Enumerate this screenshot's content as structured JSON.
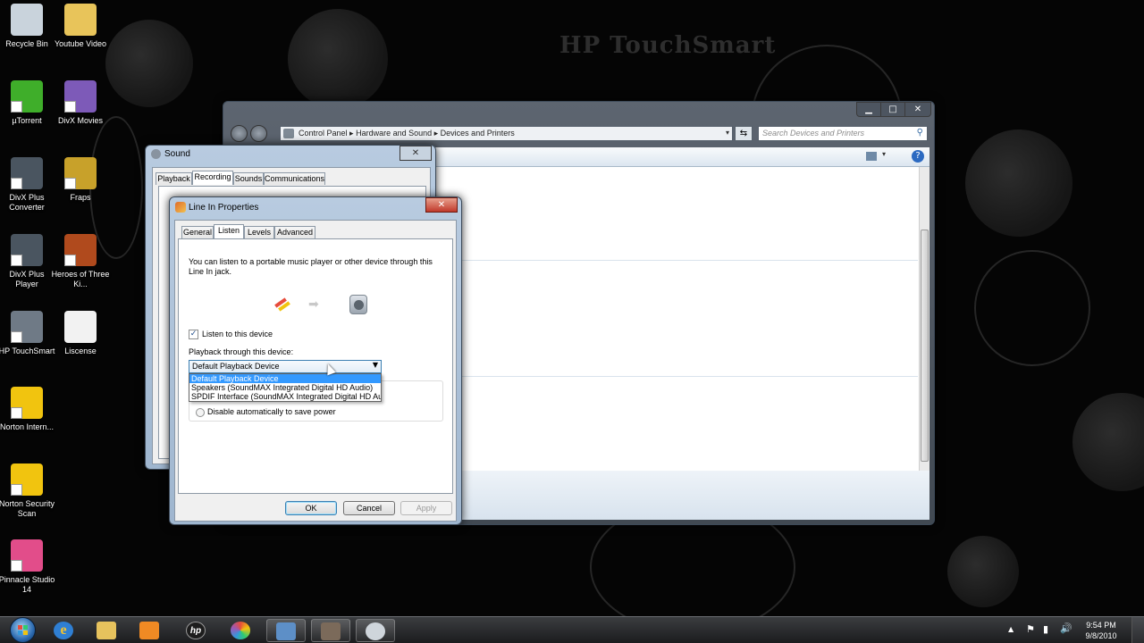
{
  "wallpaper": {
    "brand": "HP TouchSmart"
  },
  "desktop_icons": [
    {
      "label": "Recycle Bin",
      "icon": "recycle-bin-icon",
      "color": "#c9d3dc"
    },
    {
      "label": "Youtube Video",
      "icon": "folder-icon",
      "color": "#e8c45a"
    },
    {
      "label": "µTorrent",
      "icon": "utorrent-icon",
      "color": "#3fae2a"
    },
    {
      "label": "DivX Movies",
      "icon": "divx-movies-icon",
      "color": "#7d5ab8"
    },
    {
      "label": "DivX Plus Converter",
      "icon": "divx-converter-icon",
      "color": "#4a5560"
    },
    {
      "label": "Fraps",
      "icon": "fraps-icon",
      "color": "#c8a12a"
    },
    {
      "label": "DivX Plus Player",
      "icon": "divx-player-icon",
      "color": "#4a5560"
    },
    {
      "label": "Heroes of Three Ki...",
      "icon": "game-icon",
      "color": "#b04a1d"
    },
    {
      "label": "HP TouchSmart",
      "icon": "hp-touchsmart-icon",
      "color": "#6f7a86"
    },
    {
      "label": "Liscense",
      "icon": "document-icon",
      "color": "#f2f2f2"
    },
    {
      "label": "Norton Intern...",
      "icon": "norton-internet-icon",
      "color": "#f1c40f"
    },
    {
      "label": "Norton Security Scan",
      "icon": "norton-scan-icon",
      "color": "#f1c40f"
    },
    {
      "label": "Pinnacle Studio 14",
      "icon": "pinnacle-studio-icon",
      "color": "#e24d8a"
    }
  ],
  "explorer": {
    "breadcrumb": [
      "Control Panel",
      "Hardware and Sound",
      "Devices and Printers"
    ],
    "search_placeholder": "Search Devices and Printers",
    "controls": {
      "minimize": "▁",
      "maximize": "□",
      "close": "✕"
    }
  },
  "sound_dialog": {
    "title": "Sound",
    "tabs": [
      "Playback",
      "Recording",
      "Sounds",
      "Communications"
    ],
    "active_tab": "Recording"
  },
  "line_in": {
    "title": "Line In Properties",
    "tabs": [
      "General",
      "Listen",
      "Levels",
      "Advanced"
    ],
    "active_tab": "Listen",
    "description": "You can listen to a portable music player or other device through this Line In jack.",
    "listen_checkbox": {
      "label": "Listen to this device",
      "checked": true
    },
    "playback_label": "Playback through this device:",
    "selected_device": "Default Playback Device",
    "dropdown_options": [
      "Default Playback Device",
      "Speakers (SoundMAX Integrated Digital HD Audio)",
      "SPDIF Interface (SoundMAX Integrated Digital HD Au"
    ],
    "power_option": "Disable automatically to save power",
    "buttons": {
      "ok": "OK",
      "cancel": "Cancel",
      "apply": "Apply"
    }
  },
  "taskbar": {
    "clock_time": "9:54 PM",
    "clock_date": "9/8/2010",
    "show_hidden_icons": "▲"
  },
  "colors": {
    "selection": "#3399ff",
    "taskbar": "#2a2b2e",
    "window_frame": "#9fb6cf"
  }
}
